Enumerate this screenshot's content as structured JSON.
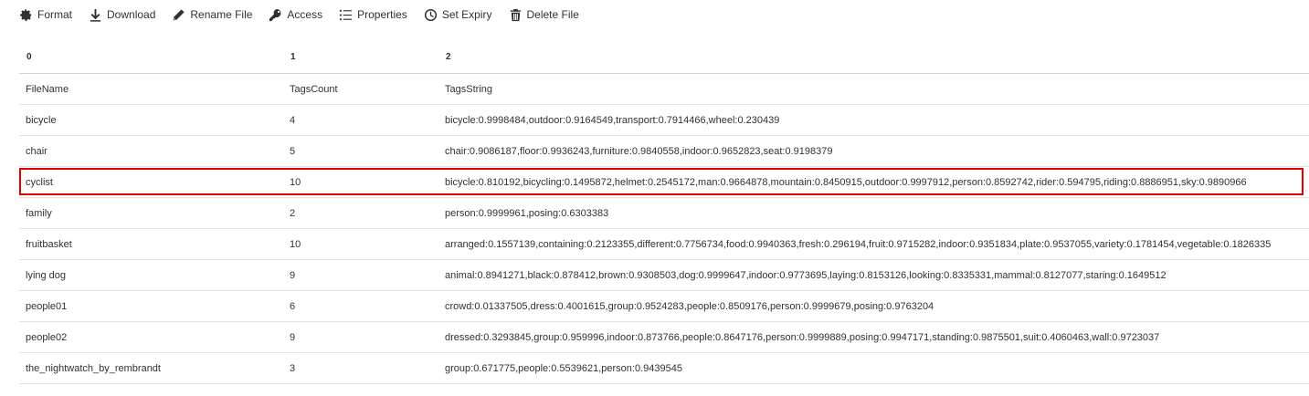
{
  "toolbar": {
    "items": [
      {
        "label": "Format",
        "icon": "gear-icon"
      },
      {
        "label": "Download",
        "icon": "download-icon"
      },
      {
        "label": "Rename File",
        "icon": "pencil-icon"
      },
      {
        "label": "Access",
        "icon": "key-icon"
      },
      {
        "label": "Properties",
        "icon": "list-icon"
      },
      {
        "label": "Set Expiry",
        "icon": "clock-icon"
      },
      {
        "label": "Delete File",
        "icon": "trash-icon"
      }
    ]
  },
  "table": {
    "column_indices": [
      "0",
      "1",
      "2"
    ],
    "rows": [
      [
        "FileName",
        "TagsCount",
        "TagsString"
      ],
      [
        "bicycle",
        "4",
        "bicycle:0.9998484,outdoor:0.9164549,transport:0.7914466,wheel:0.230439"
      ],
      [
        "chair",
        "5",
        "chair:0.9086187,floor:0.9936243,furniture:0.9840558,indoor:0.9652823,seat:0.9198379"
      ],
      [
        "cyclist",
        "10",
        "bicycle:0.810192,bicycling:0.1495872,helmet:0.2545172,man:0.9664878,mountain:0.8450915,outdoor:0.9997912,person:0.8592742,rider:0.594795,riding:0.8886951,sky:0.9890966"
      ],
      [
        "family",
        "2",
        "person:0.9999961,posing:0.6303383"
      ],
      [
        "fruitbasket",
        "10",
        "arranged:0.1557139,containing:0.2123355,different:0.7756734,food:0.9940363,fresh:0.296194,fruit:0.9715282,indoor:0.9351834,plate:0.9537055,variety:0.1781454,vegetable:0.1826335"
      ],
      [
        "lying dog",
        "9",
        "animal:0.8941271,black:0.878412,brown:0.9308503,dog:0.9999647,indoor:0.9773695,laying:0.8153126,looking:0.8335331,mammal:0.8127077,staring:0.1649512"
      ],
      [
        "people01",
        "6",
        "crowd:0.01337505,dress:0.4001615,group:0.9524283,people:0.8509176,person:0.9999679,posing:0.9763204"
      ],
      [
        "people02",
        "9",
        "dressed:0.3293845,group:0.959996,indoor:0.873766,people:0.8647176,person:0.9999889,posing:0.9947171,standing:0.9875501,suit:0.4060463,wall:0.9723037"
      ],
      [
        "the_nightwatch_by_rembrandt",
        "3",
        "group:0.671775,people:0.5539621,person:0.9439545"
      ]
    ],
    "highlighted_row_index": 3
  },
  "colors": {
    "text": "#323130",
    "highlight_border": "#e00000",
    "row_border": "#e1e1e1"
  }
}
